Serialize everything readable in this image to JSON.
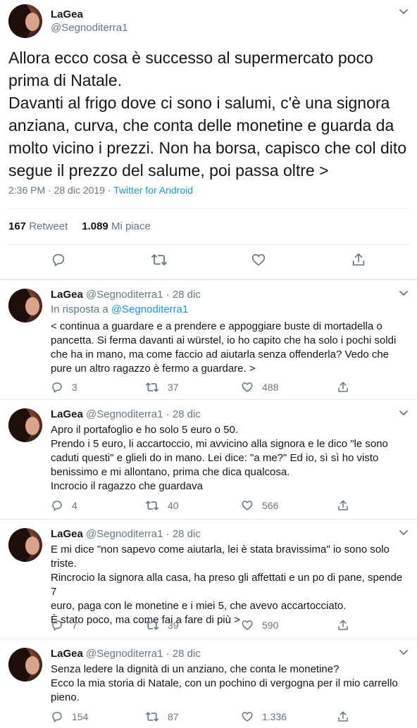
{
  "main": {
    "author_name": "LaGea",
    "author_handle": "@Segnoditerra1",
    "text": "Allora ecco cosa è successo al supermercato poco\nprima di Natale.\nDavanti al frigo dove ci sono i salumi, c'è una signora\nanziana, curva, che conta delle monetine e guarda da\nmolto vicino i prezzi. Non ha borsa, capisco che col dito\nsegue il prezzo del salume, poi passa oltre >",
    "time": "2:36 PM · 28 dic 2019 · ",
    "source": "Twitter for Android",
    "retweets_count": "167",
    "retweets_label": "Retweet",
    "likes_count": "1.089",
    "likes_label": "Mi piace"
  },
  "replies": [
    {
      "name": "LaGea",
      "handle_date": "@Segnoditerra1 · 28 dic",
      "in_reply_prefix": "In risposta a ",
      "in_reply_handle": "@Segnoditerra1",
      "text": "< continua a guardare e a prendere e appoggiare buste di mortadella o\npancetta. Si ferma davanti ai würstel, io ho capito che ha solo i pochi soldi\nche ha in mano, ma come faccio ad aiutarla senza offenderla? Vedo che\npure un altro ragazzo è fermo a guardare. >",
      "replies": "3",
      "retweets": "37",
      "likes": "488"
    },
    {
      "name": "LaGea",
      "handle_date": "@Segnoditerra1 · 28 dic",
      "text": "Apro il portafoglio e ho solo 5 euro o 50.\nPrendo i 5 euro, li accartoccio, mi avvicino alla signora e le dico \"le sono\ncaduti questi\" e glieli do in mano. Lei dice: \"a me?\" Ed io, sì sì ho visto\nbenissimo e mi allontano, prima che dica qualcosa.\nIncrocio il ragazzo che guardava",
      "replies": "4",
      "retweets": "40",
      "likes": "566"
    },
    {
      "name": "LaGea",
      "handle_date": "@Segnoditerra1 · 28 dic",
      "text": "E mi dice \"non sapevo come aiutarla, lei è stata bravissima\" io sono solo\ntriste.\nRincrocio la signora alla casa, ha preso gli affettati e un po di pane, spende 7\neuro, paga con le monetine e i miei 5, che avevo accartocciato.\nÈ stato poco, ma come fai a fare di più >",
      "replies": "7",
      "retweets": "39",
      "likes": "590"
    },
    {
      "name": "LaGea",
      "handle_date": "@Segnoditerra1 · 28 dic",
      "text": "Senza ledere la dignità di un anziano, che conta le monetine?\nEcco la mia storia di Natale, con un pochino di vergogna per il mio carrello\npieno.",
      "replies": "154",
      "retweets": "87",
      "likes": "1.336"
    }
  ],
  "icons": {
    "reply": "speech-bubble",
    "retweet": "retweet-arrows",
    "like": "heart",
    "share": "share-upload",
    "menu": "chevron-down"
  },
  "colors": {
    "link": "#1b95e0",
    "secondary": "#657786",
    "text": "#14171a",
    "divider": "#e6ecf0"
  }
}
